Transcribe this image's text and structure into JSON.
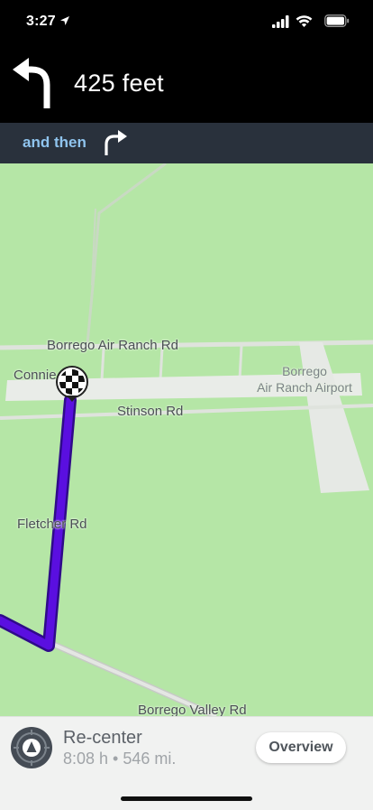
{
  "status_bar": {
    "time": "3:27",
    "icons": [
      "location-arrow-icon",
      "cellular-signal-icon",
      "wifi-icon",
      "battery-icon"
    ]
  },
  "navigation": {
    "maneuver_icon": "turn-left-arrow-icon",
    "distance": "425 feet",
    "then_label": "and then",
    "next_maneuver_icon": "turn-right-arrow-icon"
  },
  "map": {
    "labels": {
      "borrego_air_ranch_rd": "Borrego Air Ranch Rd",
      "connie": "Connie",
      "stinson_rd": "Stinson Rd",
      "fletcher_rd": "Fletcher Rd",
      "borrego_valley_rd": "Borrego Valley Rd",
      "airport_line1": "Borrego",
      "airport_line2": "Air Ranch Airport"
    },
    "destination_icon": "checkered-flag-icon",
    "colors": {
      "land": "#b5e6a6",
      "road": "#e9ece8",
      "route": "#5a0fe0",
      "route_outline": "#2f0a8a"
    }
  },
  "bottom_panel": {
    "recenter_label": "Re-center",
    "trip_info": "8:08 h • 546 mi.",
    "overview_label": "Overview"
  }
}
